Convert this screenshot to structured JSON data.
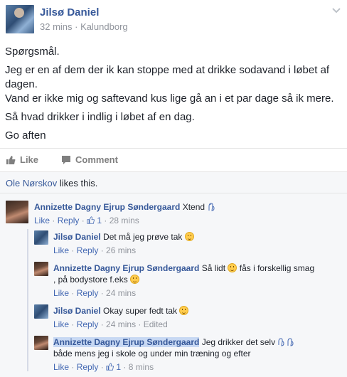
{
  "post": {
    "author": "Jilsø Daniel",
    "time": "32 mins",
    "separator": "·",
    "location": "Kalundborg",
    "paragraphs": [
      "Spørgsmål.",
      "Jeg er en af dem der ik kan stoppe med at drikke sodavand i løbet af dagen.",
      "Vand er ikke mig og saftevand kus lige gå an i et par dage så ik mere.",
      "Så hvad drikker i indlig i løbet af en dag.",
      "Go aften"
    ]
  },
  "actions": {
    "like_label": "Like",
    "comment_label": "Comment"
  },
  "likes": {
    "liker": "Ole Nørskov",
    "suffix": "likes this."
  },
  "comments": [
    {
      "author": "Annizette Dagny Ejrup Søndergaard",
      "text": "Xtend",
      "like": "Like",
      "reply": "Reply",
      "like_count": "1",
      "time": "28 mins"
    },
    {
      "author": "Jilsø Daniel",
      "text": "Det må jeg prøve tak",
      "like": "Like",
      "reply": "Reply",
      "time": "26 mins"
    },
    {
      "author": "Annizette Dagny Ejrup Søndergaard",
      "text_a": "Så lidt",
      "text_b": "fås i forskellig smag",
      "text_c": ", på bodystore f.eks",
      "like": "Like",
      "reply": "Reply",
      "time": "24 mins"
    },
    {
      "author": "Jilsø Daniel",
      "text": "Okay super fedt tak",
      "like": "Like",
      "reply": "Reply",
      "time": "24 mins",
      "edited": "Edited"
    },
    {
      "author": "Annizette Dagny Ejrup Søndergaard",
      "text_a": "Jeg drikker det selv",
      "text_b": "både mens jeg i skole og under min træning og efter",
      "like": "Like",
      "reply": "Reply",
      "like_count": "1",
      "time": "8 mins"
    }
  ],
  "colors": {
    "link": "#365899",
    "muted": "#90949c",
    "highlight": "#c7d8f3"
  }
}
